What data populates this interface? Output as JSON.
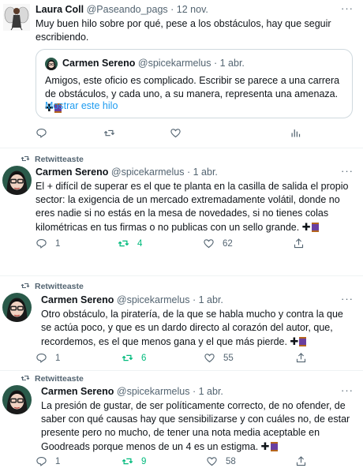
{
  "tweets": [
    {
      "name": "Laura Coll",
      "handle": "@Paseando_pags",
      "date": "12 nov.",
      "text": "Muy buen hilo sobre por qué, pese a los obstáculos, hay que seguir escribiendo.",
      "quote": {
        "name": "Carmen Sereno",
        "handle": "@spicekarmelus",
        "date": "1 abr.",
        "text": "Amigos, este oficio es complicado. Escribir se parece a una carrera de obstáculos, y cada uno, a su manera, representa una amenaza.",
        "show_more": "Mostrar este hilo"
      }
    },
    {
      "retweeted": "Retwitteaste",
      "name": "Carmen Sereno",
      "handle": "@spicekarmelus",
      "date": "1 abr.",
      "text": "El + difícil de superar es el que te planta en la casilla de salida el propio sector: la exigencia de un mercado extremadamente volátil, donde no eres nadie si no estás en la mesa de novedades, si no tienes colas kilométricas en tus firmas o no publicas con un sello grande.",
      "replies": "1",
      "retweets": "4",
      "likes": "62"
    },
    {
      "retweeted": "Retwitteaste",
      "name": "Carmen Sereno",
      "handle": "@spicekarmelus",
      "date": "1 abr.",
      "text": "Otro obstáculo, la piratería, de la que se habla mucho y contra la que se actúa poco, y que es un dardo directo al corazón del autor, que, recordemos, es el que menos gana y el que más pierde.",
      "replies": "1",
      "retweets": "6",
      "likes": "55"
    },
    {
      "retweeted": "Retwitteaste",
      "name": "Carmen Sereno",
      "handle": "@spicekarmelus",
      "date": "1 abr.",
      "text": "La presión de gustar, de ser políticamente correcto, de no ofender, de saber con qué causas hay que sensibilizarse y con cuáles no, de estar presente pero no mucho, de tener una nota media aceptable en Goodreads porque menos de un 4 es un estigma.",
      "replies": "1",
      "retweets": "9",
      "likes": "58"
    }
  ],
  "icons": {
    "reply": "reply-icon",
    "retweet": "retweet-icon",
    "like": "heart-icon",
    "analytics": "analytics-icon",
    "share": "share-icon",
    "more": "more-icon",
    "emoji": [
      "heavy-plus-sign-emoji",
      "thread-spool-emoji"
    ]
  },
  "colors": {
    "accent": "#1d9bf0",
    "retweet_active": "#00ba7c",
    "secondary_text": "#536471",
    "spool": "#6a3fa0"
  }
}
